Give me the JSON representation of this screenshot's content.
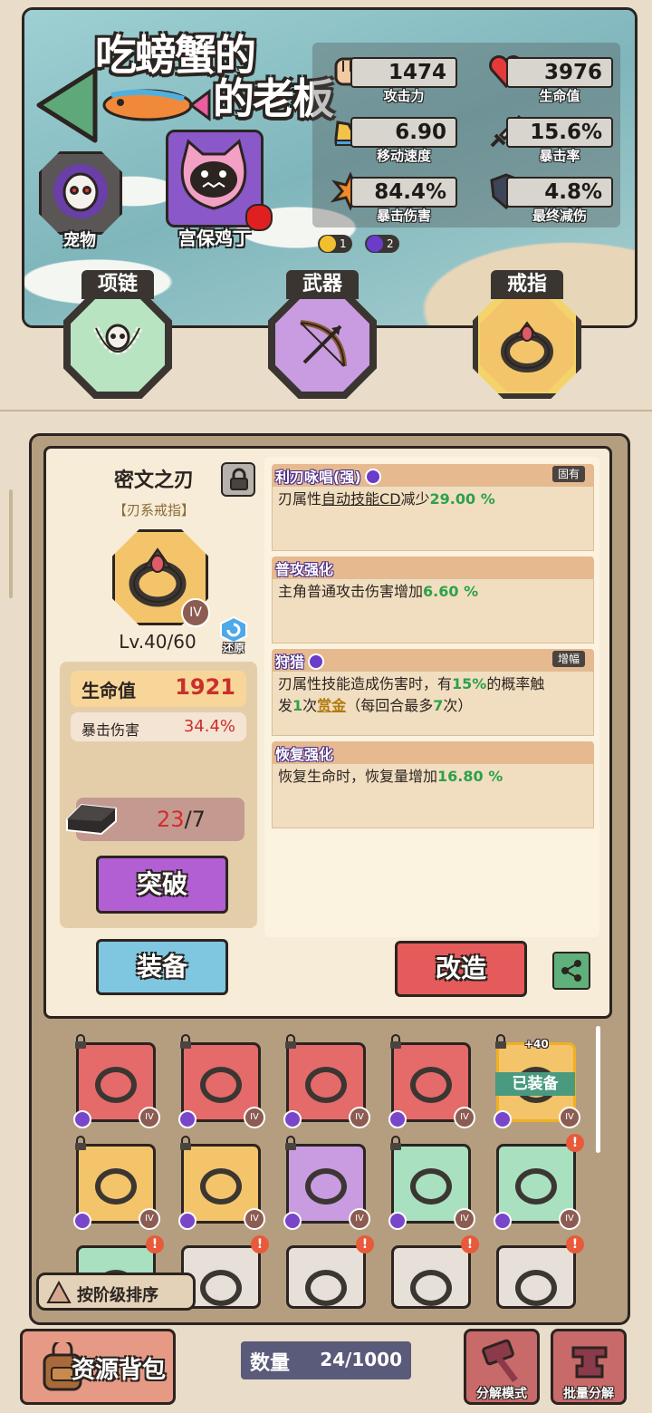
{
  "header": {
    "title_line1": "吃螃蟹的",
    "title_line2": "的老板"
  },
  "stats": [
    {
      "value": "1474",
      "label": "攻击力",
      "icon": "fist-icon"
    },
    {
      "value": "3976",
      "label": "生命值",
      "icon": "heart-icon"
    },
    {
      "value": "6.90",
      "label": "移动速度",
      "icon": "shoe-icon"
    },
    {
      "value": "15.6%",
      "label": "暴击率",
      "icon": "sword-icon"
    },
    {
      "value": "84.4%",
      "label": "暴击伤害",
      "icon": "explosion-icon"
    },
    {
      "value": "4.8%",
      "label": "最终减伤",
      "icon": "shield-icon"
    }
  ],
  "buff_badges": [
    {
      "count": "1",
      "color": "#f0c030"
    },
    {
      "count": "2",
      "color": "#6b3bc9"
    }
  ],
  "pet": {
    "label": "宠物"
  },
  "character": {
    "name": "宫保鸡丁"
  },
  "slots": [
    {
      "label": "项链",
      "icon": "skull-necklace-icon",
      "color": "#b9e4c2"
    },
    {
      "label": "武器",
      "icon": "crossbow-icon",
      "color": "#c99be0"
    },
    {
      "label": "戒指",
      "icon": "ring-icon",
      "color": "#f4c46a"
    }
  ],
  "item": {
    "name": "密文之刃",
    "type": "【刃系戒指】",
    "tier": "IV",
    "level": "Lv.40/60",
    "restore_label": "还原",
    "main_stat_label": "生命值",
    "main_stat_value": "1921",
    "sub_stat_label": "暴击伤害",
    "sub_stat_value": "34.4%",
    "material_have": "23",
    "material_sep": "/",
    "material_need": "7",
    "breakthrough_label": "突破",
    "equip_label": "装备",
    "reforge_label": "改造"
  },
  "affixes": [
    {
      "name": "利刃咏唱(强)",
      "tag": "固有",
      "text_parts": [
        "刃属性",
        "自动技能CD",
        "减少",
        "29.00 %"
      ]
    },
    {
      "name": "普攻强化",
      "tag": "",
      "text_parts": [
        "主角普通攻击伤害增加",
        "6.60 %"
      ]
    },
    {
      "name": "狩猎",
      "tag": "增幅",
      "text_parts": [
        "刃属性技能造成伤害时，有",
        "15%",
        "的概率触",
        "发",
        "1",
        "次",
        "赏金",
        "（每回合最多",
        "7",
        "次）"
      ]
    },
    {
      "name": "恢复强化",
      "tag": "",
      "text_parts": [
        "恢复生命时，恢复量增加",
        "16.80 %"
      ]
    }
  ],
  "inventory": {
    "equipped_label": "已装备",
    "equipped_bonus": "+40",
    "tier_label": "IV",
    "items": [
      {
        "color": "#e56a6a",
        "locked": true,
        "alert": false
      },
      {
        "color": "#e56a6a",
        "locked": true,
        "alert": false
      },
      {
        "color": "#e56a6a",
        "locked": true,
        "alert": false
      },
      {
        "color": "#e56a6a",
        "locked": true,
        "alert": false
      },
      {
        "color": "#f4c46a",
        "locked": true,
        "alert": false,
        "equipped": true
      },
      {
        "color": "#f4c46a",
        "locked": true,
        "alert": false
      },
      {
        "color": "#f4c46a",
        "locked": true,
        "alert": false
      },
      {
        "color": "#c99be0",
        "locked": true,
        "alert": false
      },
      {
        "color": "#a8e0c0",
        "locked": true,
        "alert": false
      },
      {
        "color": "#a8e0c0",
        "locked": false,
        "alert": true
      },
      {
        "color": "#a8e0c0",
        "locked": false,
        "alert": true
      },
      {
        "color": "#e6e0d8",
        "locked": false,
        "alert": true
      },
      {
        "color": "#e6e0d8",
        "locked": false,
        "alert": true
      },
      {
        "color": "#e6e0d8",
        "locked": false,
        "alert": true
      },
      {
        "color": "#e6e0d8",
        "locked": false,
        "alert": true
      }
    ]
  },
  "sort_label": "按阶级排序",
  "bottom": {
    "bag_label": "资源背包",
    "count_label": "数量",
    "count_value": "24/1000",
    "decompose_mode": "分解模式",
    "batch_decompose": "批量分解"
  }
}
